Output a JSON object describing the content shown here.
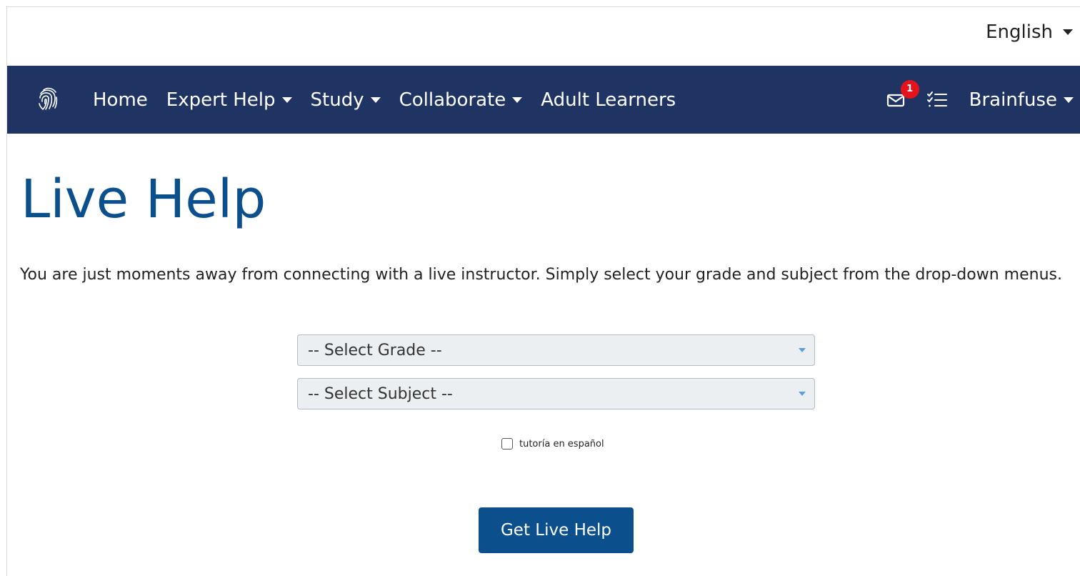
{
  "language": {
    "label": "English"
  },
  "nav": {
    "items": [
      {
        "label": "Home",
        "dropdown": false
      },
      {
        "label": "Expert Help",
        "dropdown": true
      },
      {
        "label": "Study",
        "dropdown": true
      },
      {
        "label": "Collaborate",
        "dropdown": true
      },
      {
        "label": "Adult Learners",
        "dropdown": false
      }
    ],
    "mail_badge": "1",
    "account_label": "Brainfuse",
    "icons": [
      "fingerprint-logo-icon",
      "mail-icon",
      "task-list-icon"
    ]
  },
  "page": {
    "title": "Live Help",
    "intro": "You are just moments away from connecting with a live instructor. Simply select your grade and subject from the drop-down menus."
  },
  "form": {
    "grade_select": "-- Select Grade --",
    "subject_select": "-- Select Subject --",
    "spanish_label": "tutoría en español",
    "spanish_checked": false,
    "submit_label": "Get Live Help"
  },
  "colors": {
    "navbar": "#1f3462",
    "title": "#0b4f8c",
    "button": "#0b4f8c",
    "badge": "#e4131c"
  }
}
